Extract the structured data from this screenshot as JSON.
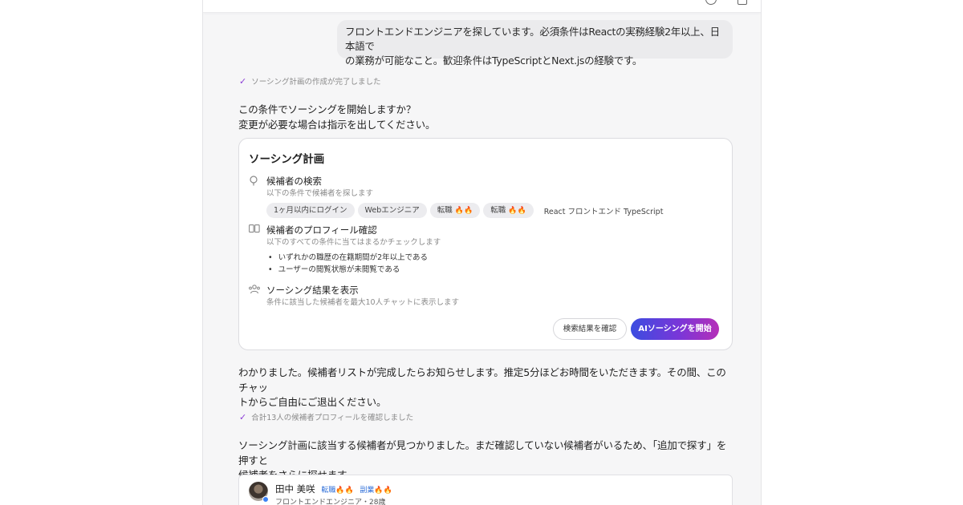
{
  "user_message": {
    "line1": "フロントエンドエンジニアを探しています。必須条件はReactの実務経験2年以上、日本語で",
    "line2": "の業務が可能なこと。歓迎条件はTypeScriptとNext.jsの経験です。"
  },
  "status1": {
    "icon": "check-icon",
    "text": "ソーシング計画の作成が完了しました"
  },
  "prompt": {
    "line1": "この条件でソーシングを開始しますか？",
    "line2": "変更が必要な場合は指示を出してください。"
  },
  "plan": {
    "title": "ソーシング計画",
    "steps": [
      {
        "icon": "search-icon",
        "title": "候補者の検索",
        "desc": "以下の条件で候補者を探します"
      },
      {
        "icon": "profile-check-icon",
        "title": "候補者のプロフィール確認",
        "desc": "以下のすべての条件に当てはまるかチェックします"
      },
      {
        "icon": "people-icon",
        "title": "ソーシング結果を表示",
        "desc": "条件に該当した候補者を最大10人チャットに表示します"
      }
    ],
    "chips": [
      {
        "label": "1ヶ月以内にログイン"
      },
      {
        "label": "Webエンジニア"
      },
      {
        "label": "転職",
        "flames": "🔥",
        "flames_dim": "🔥"
      },
      {
        "label": "転職",
        "flames": "🔥🔥"
      }
    ],
    "keywords": "React フロントエンド TypeScript",
    "bullets": [
      "いずれかの職歴の在籍期間が2年以上である",
      "ユーザーの閲覧状態が未閲覧である"
    ],
    "secondary_button": "検索結果を確認",
    "primary_button": "AIソーシングを開始"
  },
  "reply": {
    "line1": "わかりました。候補者リストが完成したらお知らせします。推定5分ほどお時間をいただきます。その間、このチャッ",
    "line2": "トからご自由にご退出ください。"
  },
  "status2": {
    "icon": "check-icon",
    "text": "合計13人の候補者プロフィールを確認しました"
  },
  "result": {
    "line1": "ソーシング計画に該当する候補者が見つかりました。まだ確認していない候補者がいるため、「追加で探す」を押すと",
    "line2": "候補者をさらに探せます。"
  },
  "candidate": {
    "name": "田中 美咲",
    "tag1": "転職",
    "tag1_flames": "🔥🔥",
    "tag2": "副業",
    "tag2_flames": "🔥🔥",
    "subtitle": "フロントエンドエンジニア・28歳"
  },
  "colors": {
    "accent": "#8b3dd6",
    "flame": "#2f6fd8",
    "primary_gradient_start": "#3b4de0",
    "primary_gradient_end": "#b52fb8"
  }
}
